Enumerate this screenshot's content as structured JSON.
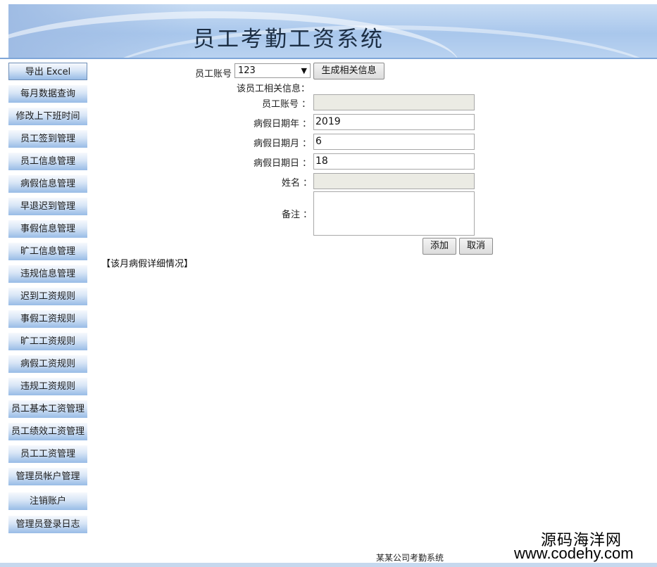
{
  "header": {
    "title": "员工考勤工资系统"
  },
  "sidebar": {
    "items": [
      {
        "label": "导出 Excel"
      },
      {
        "label": "每月数据查询"
      },
      {
        "label": "修改上下班时间"
      },
      {
        "label": "员工签到管理"
      },
      {
        "label": "员工信息管理"
      },
      {
        "label": "病假信息管理"
      },
      {
        "label": "早退迟到管理"
      },
      {
        "label": "事假信息管理"
      },
      {
        "label": "旷工信息管理"
      },
      {
        "label": "违规信息管理"
      },
      {
        "label": "迟到工资规则"
      },
      {
        "label": "事假工资规则"
      },
      {
        "label": "旷工工资规则"
      },
      {
        "label": "病假工资规则"
      },
      {
        "label": "违规工资规则"
      },
      {
        "label": "员工基本工资管理"
      },
      {
        "label": "员工绩效工资管理"
      },
      {
        "label": "员工工资管理"
      },
      {
        "label": "管理员帐户管理"
      },
      {
        "label": "注销账户"
      },
      {
        "label": "管理员登录日志"
      }
    ]
  },
  "form": {
    "account_label": "员工账号",
    "account_select_value": "123",
    "generate_button": "生成相关信息",
    "info_heading": "该员工相关信息：",
    "fields": {
      "account": {
        "label": "员工账号 ：",
        "value": ""
      },
      "year": {
        "label": "病假日期年 ：",
        "value": "2019"
      },
      "month": {
        "label": "病假日期月 ：",
        "value": "6"
      },
      "day": {
        "label": "病假日期日 ：",
        "value": "18"
      },
      "name": {
        "label": "姓名 ：",
        "value": ""
      },
      "note": {
        "label": "备注 ：",
        "value": ""
      }
    },
    "add_button": "添加",
    "cancel_button": "取消"
  },
  "section": {
    "detail_label": "【该月病假详细情况】"
  },
  "footer": {
    "text": "某某公司考勤系统"
  },
  "watermark": {
    "line1": "源码海洋网",
    "line2": "www.codehy.com"
  },
  "colors": {
    "banner": "#a9c7ec",
    "nav_button": "#98bbe6",
    "readonly_field": "#ebebe4"
  }
}
